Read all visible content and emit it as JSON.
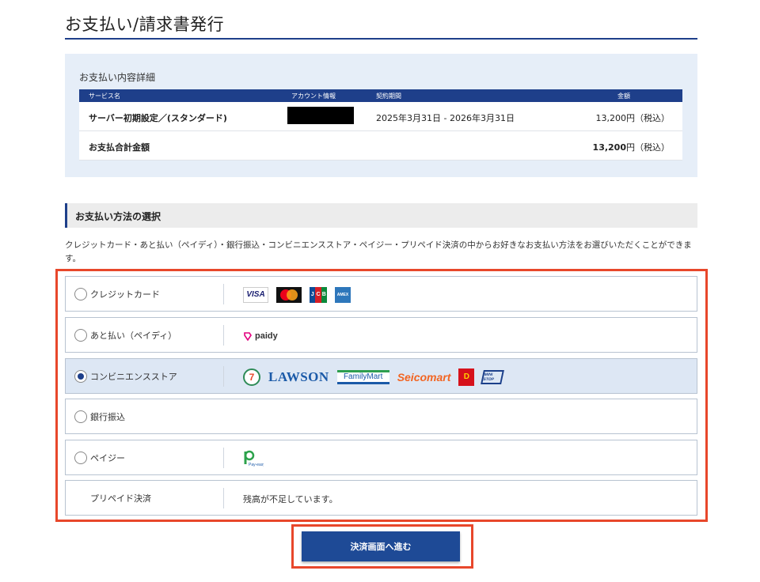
{
  "page": {
    "title": "お支払い/請求書発行"
  },
  "payment_detail": {
    "caption": "お支払い内容詳細",
    "columns": [
      "サービス名",
      "アカウント情報",
      "契約期間",
      "金額"
    ],
    "row": {
      "service": "サーバー初期設定／(スタンダード)",
      "period": "2025年3月31日 - 2026年3月31日",
      "amount": "13,200円（税込）"
    },
    "total": {
      "label": "お支払合計金額",
      "amount_value": "13,200",
      "amount_suffix": "円（税込）"
    }
  },
  "method_section": {
    "heading": "お支払い方法の選択",
    "intro": "クレジットカード・あと払い（ペイディ）・銀行振込・コンビニエンスストア・ペイジー・プリペイド決済の中からお好きなお支払い方法をお選びいただくことができます。"
  },
  "options": [
    {
      "label": "クレジットカード",
      "selected": false,
      "logos": [
        "VISA",
        "mastercard",
        "JCB",
        "AMEX"
      ]
    },
    {
      "label": "あと払い（ペイディ）",
      "selected": false,
      "logos": [
        "paidy"
      ]
    },
    {
      "label": "コンビニエンスストア",
      "selected": true,
      "logos": [
        "7",
        "LAWSON",
        "FamilyMart",
        "Seicomart",
        "Daily",
        "MINI STOP"
      ]
    },
    {
      "label": "銀行振込",
      "selected": false,
      "logos": []
    },
    {
      "label": "ペイジー",
      "selected": false,
      "logos": [
        "Pay-easy"
      ]
    },
    {
      "label": "プリペイド決済",
      "selected": false,
      "note": "残高が不足しています。"
    }
  ],
  "submit": {
    "label": "決済画面へ進む"
  },
  "colors": {
    "brand_navy": "#1e3f8a",
    "highlight_red": "#e8472b",
    "selected_bg": "#dde7f4"
  }
}
